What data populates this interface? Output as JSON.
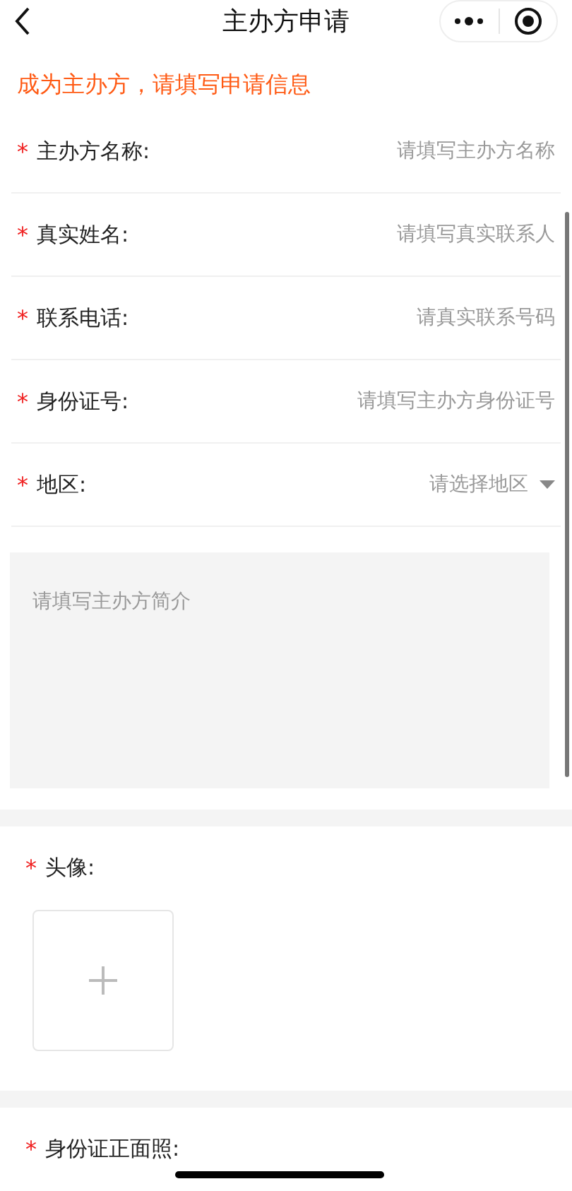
{
  "nav": {
    "title": "主办方申请"
  },
  "notice": "成为主办方，请填写申请信息",
  "fields": [
    {
      "kind": "input",
      "mark": "*",
      "label": "主办方名称:",
      "placeholder": "请填写主办方名称"
    },
    {
      "kind": "input",
      "mark": "*",
      "label": "真实姓名:",
      "placeholder": "请填写真实联系人"
    },
    {
      "kind": "input",
      "mark": "*",
      "label": "联系电话:",
      "placeholder": "请真实联系号码"
    },
    {
      "kind": "input",
      "mark": "*",
      "label": "身份证号:",
      "placeholder": "请填写主办方身份证号"
    },
    {
      "kind": "select",
      "mark": "*",
      "label": "地区:",
      "placeholder": "请选择地区"
    }
  ],
  "intro": {
    "placeholder": "请填写主办方简介"
  },
  "uploads": [
    {
      "mark": "*",
      "label": "头像:",
      "has_picker": true
    },
    {
      "mark": "*",
      "label": "身份证正面照:",
      "has_picker": false
    }
  ]
}
